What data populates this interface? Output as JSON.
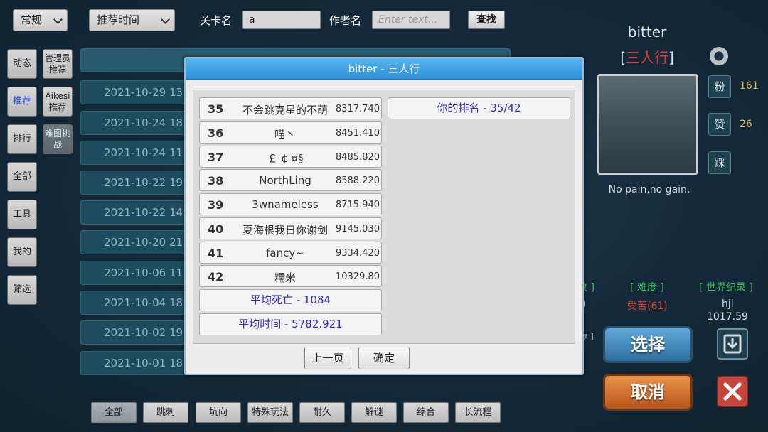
{
  "topbar": {
    "category_select": "常规",
    "sort_select": "推荐时间",
    "level_label": "关卡名",
    "level_value": "a",
    "author_label": "作者名",
    "author_placeholder": "Enter text...",
    "search_button": "查找"
  },
  "left_nav": {
    "items": [
      "动态",
      "推荐",
      "排行",
      "全部",
      "工具",
      "我的",
      "筛选"
    ],
    "active": "推荐",
    "sub_items": [
      "管理员推荐",
      "Aikesi推荐",
      "难图挑战"
    ]
  },
  "list": {
    "rows": [
      "2021-10-29 13:4",
      "2021-10-24 18:2",
      "2021-10-24 11:3",
      "2021-10-22 19:0",
      "2021-10-22 14:4",
      "2021-10-20 21:4",
      "2021-10-06 11:4",
      "2021-10-04 18:4",
      "2021-10-02 19:3",
      "2021-10-01 18:5"
    ]
  },
  "bottom_tabs": [
    "全部",
    "跳刺",
    "坑向",
    "特殊玩法",
    "耐久",
    "解谜",
    "综合",
    "长流程"
  ],
  "profile": {
    "name": "bitter",
    "title_open": "[",
    "title": "三人行",
    "title_close": "]",
    "fans_label": "粉",
    "fans_count": "161",
    "likes_label": "赞",
    "likes_count": "26",
    "dislike_label": "踩",
    "motto": "No pain,no gain.",
    "info_labels": [
      "数 ]",
      "[ 难度 ]",
      "[ 世界纪录 ]"
    ],
    "count_value": ")",
    "difficulty_value": "受苦(61)",
    "record_holder": "hjl",
    "record_time": "1017.59",
    "side_note": "厚 ]",
    "select_button": "选择",
    "cancel_button": "取消"
  },
  "colors": {
    "modal_header": "#3aa2e6",
    "rank_text": "#2c2ccc",
    "difficulty_red": "#e03a2a",
    "label_green": "#3fbf5a",
    "count_gold": "#e0b84a"
  },
  "modal": {
    "title": "bitter - 三人行",
    "rankings": [
      {
        "rank": "35",
        "name": "不会跳克星的不萌",
        "time": "8317.740"
      },
      {
        "rank": "36",
        "name": "喵丶",
        "time": "8451.410"
      },
      {
        "rank": "37",
        "name": "￡ ¢ ¤§",
        "time": "8485.820"
      },
      {
        "rank": "38",
        "name": "NorthLing",
        "time": "8588.220"
      },
      {
        "rank": "39",
        "name": "3wnameless",
        "time": "8715.940"
      },
      {
        "rank": "40",
        "name": "夏海根我日你谢剑",
        "time": "9145.030"
      },
      {
        "rank": "41",
        "name": "fancy~",
        "time": "9334.420"
      },
      {
        "rank": "42",
        "name": "糯米",
        "time": "10329.80"
      }
    ],
    "avg_deaths": "平均死亡 - 1084",
    "avg_time": "平均时间 - 5782.921",
    "my_rank": "你的排名 - 35/42",
    "prev_button": "上一页",
    "confirm_button": "确定"
  }
}
